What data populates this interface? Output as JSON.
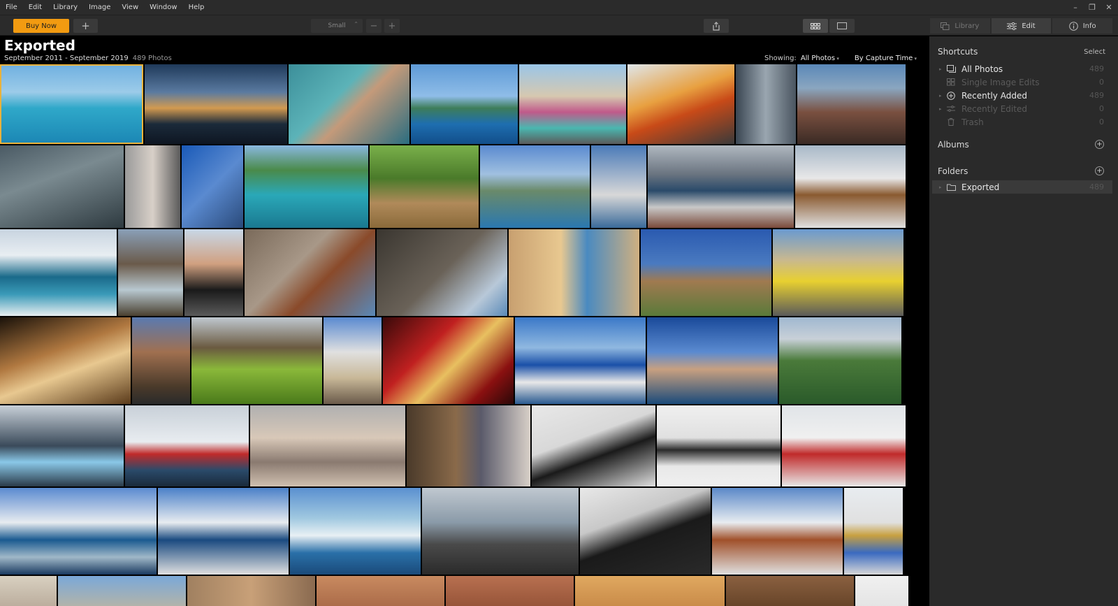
{
  "menu": [
    "File",
    "Edit",
    "Library",
    "Image",
    "View",
    "Window",
    "Help"
  ],
  "toolbar": {
    "buy_label": "Buy Now",
    "size_value": "Small",
    "modes": [
      {
        "label": "Library",
        "icon": "library-icon"
      },
      {
        "label": "Edit",
        "icon": "sliders-icon"
      },
      {
        "label": "Info",
        "icon": "info-icon"
      }
    ]
  },
  "header": {
    "title": "Exported",
    "date_range": "September 2011 - September 2019",
    "count": "489 Photos",
    "showing_label": "Showing:",
    "filter": "All Photos",
    "sort": "By Capture Time"
  },
  "sidebar": {
    "shortcuts_title": "Shortcuts",
    "select_label": "Select",
    "shortcuts": [
      {
        "label": "All Photos",
        "count": "489",
        "icon": "photos-icon",
        "enabled": true
      },
      {
        "label": "Single Image Edits",
        "count": "0",
        "icon": "grid-icon",
        "enabled": false
      },
      {
        "label": "Recently Added",
        "count": "489",
        "icon": "plus-circle-icon",
        "enabled": true
      },
      {
        "label": "Recently Edited",
        "count": "0",
        "icon": "sliders-icon",
        "enabled": false
      },
      {
        "label": "Trash",
        "count": "0",
        "icon": "trash-icon",
        "enabled": false
      }
    ],
    "albums_title": "Albums",
    "folders_title": "Folders",
    "folders": [
      {
        "label": "Exported",
        "count": "489"
      }
    ]
  },
  "colors": {
    "accent": "#f29b11",
    "selection": "#e8b23c",
    "sidebar_bg": "#2a2a2a",
    "toolbar_bg": "#2b2b2b"
  }
}
